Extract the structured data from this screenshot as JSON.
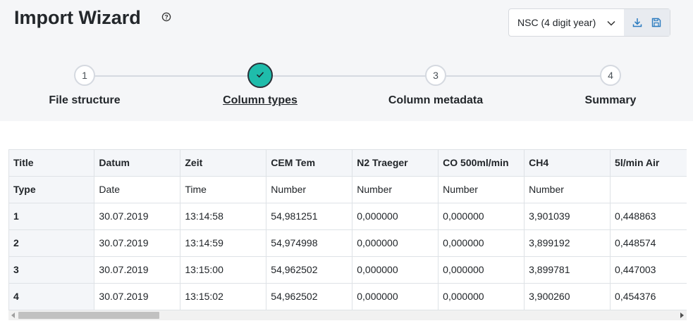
{
  "header": {
    "title": "Import Wizard"
  },
  "toolbar": {
    "date_format": "NSC (4 digit year)"
  },
  "steps": [
    {
      "number": "1",
      "label": "File structure",
      "state": "pending"
    },
    {
      "number": "",
      "label": "Column types",
      "state": "done"
    },
    {
      "number": "3",
      "label": "Column metadata",
      "state": "pending"
    },
    {
      "number": "4",
      "label": "Summary",
      "state": "pending"
    }
  ],
  "table": {
    "title_row_label": "Title",
    "type_row_label": "Type",
    "columns": [
      "Datum",
      "Zeit",
      "CEM Tem",
      "N2 Traeger",
      "CO 500ml/min",
      "CH4",
      "5l/min Air"
    ],
    "types": [
      "Date",
      "Time",
      "Number",
      "Number",
      "Number",
      "Number",
      ""
    ],
    "rows": [
      {
        "index": "1",
        "cells": [
          "30.07.2019",
          "13:14:58",
          "54,981251",
          "0,000000",
          "0,000000",
          "3,901039",
          "0,448863"
        ]
      },
      {
        "index": "2",
        "cells": [
          "30.07.2019",
          "13:14:59",
          "54,974998",
          "0,000000",
          "0,000000",
          "3,899192",
          "0,448574"
        ]
      },
      {
        "index": "3",
        "cells": [
          "30.07.2019",
          "13:15:00",
          "54,962502",
          "0,000000",
          "0,000000",
          "3,899781",
          "0,447003"
        ]
      },
      {
        "index": "4",
        "cells": [
          "30.07.2019",
          "13:15:02",
          "54,962502",
          "0,000000",
          "0,000000",
          "3,900260",
          "0,454376"
        ]
      }
    ]
  },
  "colors": {
    "accent": "#1fbcab",
    "icon_blue": "#2b7bbf"
  }
}
